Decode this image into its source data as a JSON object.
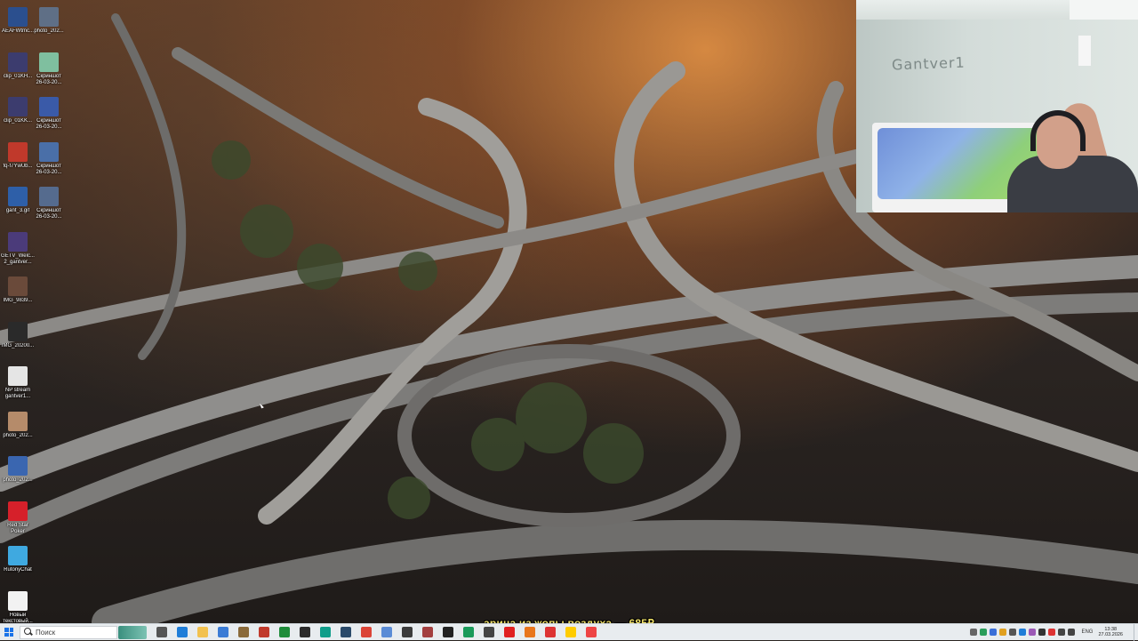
{
  "desktop": {
    "icons_col1": [
      {
        "label": "AEAFWtmc...",
        "icon": "app-icon",
        "color": "#2b4f8e"
      },
      {
        "label": "clip_01KH...",
        "icon": "video-file-icon",
        "color": "#3c3c6e"
      },
      {
        "label": "clip_01KK...",
        "icon": "video-file-icon",
        "color": "#3c3c6e"
      },
      {
        "label": "fq-f7YwUb...",
        "icon": "image-file-icon",
        "color": "#c0392b"
      },
      {
        "label": "gant_3.gif",
        "icon": "gif-file-icon",
        "color": "#2e5fa8"
      },
      {
        "label": "GETV_Welc...\n2_gantver...",
        "icon": "video-file-icon",
        "color": "#4b3b7a"
      },
      {
        "label": "IMG_9839...",
        "icon": "image-file-icon",
        "color": "#6a4a3a"
      },
      {
        "label": "IMG_20200...",
        "icon": "image-file-icon",
        "color": "#2a2a2a"
      },
      {
        "label": "NP stream\ngantver1...",
        "icon": "text-file-icon",
        "color": "#e5e5e5"
      },
      {
        "label": "photo_202...",
        "icon": "image-file-icon",
        "color": "#b58b6a"
      },
      {
        "label": "photo_202...",
        "icon": "image-file-icon",
        "color": "#3a66b0"
      },
      {
        "label": "Red Star\nPoker",
        "icon": "red-star-poker-icon",
        "color": "#d6202a"
      },
      {
        "label": "RutonyChat",
        "icon": "chat-app-icon",
        "color": "#3fa9e0"
      },
      {
        "label": "Новый\nтекстовый...",
        "icon": "text-file-icon",
        "color": "#f2f2f2"
      }
    ],
    "icons_col2": [
      {
        "label": "photo_202...",
        "icon": "image-file-icon",
        "color": "#5f6f86"
      },
      {
        "label": "Скриншот\n26-03-20...",
        "icon": "screenshot-file-icon",
        "color": "#7fbf9f"
      },
      {
        "label": "Скриншот\n26-03-20...",
        "icon": "screenshot-file-icon",
        "color": "#3a5aa8"
      },
      {
        "label": "Скриншот\n26-03-20...",
        "icon": "screenshot-file-icon",
        "color": "#4a6fa8"
      },
      {
        "label": "Скриншот\n26-03-20...",
        "icon": "screenshot-file-icon",
        "color": "#556b8e"
      }
    ]
  },
  "webcam": {
    "wall_sign": "Gantver1"
  },
  "overlay": {
    "donation_text": "арина из жопы воздуха — 685₽"
  },
  "taskbar": {
    "search_placeholder": "Поиск",
    "pinned_apps": [
      {
        "icon": "task-view-icon",
        "color": "#555555"
      },
      {
        "icon": "edge-browser-icon",
        "color": "#1f7dd8"
      },
      {
        "icon": "file-explorer-icon",
        "color": "#f2c14e"
      },
      {
        "icon": "store-icon",
        "color": "#3a7bd5"
      },
      {
        "icon": "pen-app-icon",
        "color": "#8a6a3a"
      },
      {
        "icon": "app-64-icon",
        "color": "#c0392b"
      },
      {
        "icon": "terminal-icon",
        "color": "#1e8c3a"
      },
      {
        "icon": "obs-icon",
        "color": "#2b2b2b"
      },
      {
        "icon": "edge-icon",
        "color": "#0f9d8a"
      },
      {
        "icon": "steam-icon",
        "color": "#2a4a6a"
      },
      {
        "icon": "chrome-icon",
        "color": "#db4437"
      },
      {
        "icon": "document-icon",
        "color": "#5b8cd6"
      },
      {
        "icon": "notepad-icon",
        "color": "#3c3c3c"
      },
      {
        "icon": "app-icon",
        "color": "#a33f3f"
      },
      {
        "icon": "app-icon",
        "color": "#222222"
      },
      {
        "icon": "pin-icon",
        "color": "#1a9a5a"
      },
      {
        "icon": "app-icon",
        "color": "#444444"
      },
      {
        "icon": "yandex-icon",
        "color": "#e02020"
      },
      {
        "icon": "firefox-icon",
        "color": "#e8761c"
      },
      {
        "icon": "app-icon",
        "color": "#d33"
      },
      {
        "icon": "yandex-browser-icon",
        "color": "#ffcc00"
      },
      {
        "icon": "app-icon",
        "color": "#e44"
      }
    ],
    "language": "ENG",
    "clock_time": "13:38",
    "clock_date": "27.03.2026",
    "tray_icons": [
      {
        "icon": "chevron-up-icon",
        "color": "#666666"
      },
      {
        "icon": "tray-app-icon",
        "color": "#2a9d5a"
      },
      {
        "icon": "tray-app-icon",
        "color": "#3a6fd8"
      },
      {
        "icon": "tray-app-icon",
        "color": "#e0a020"
      },
      {
        "icon": "tray-app-icon",
        "color": "#555555"
      },
      {
        "icon": "tray-app-icon",
        "color": "#1f7dd8"
      },
      {
        "icon": "tray-app-icon",
        "color": "#9b59b6"
      },
      {
        "icon": "tray-app-icon",
        "color": "#333333"
      },
      {
        "icon": "tray-app-icon",
        "color": "#d33"
      },
      {
        "icon": "network-icon",
        "color": "#444444"
      },
      {
        "icon": "volume-icon",
        "color": "#444444"
      }
    ]
  }
}
